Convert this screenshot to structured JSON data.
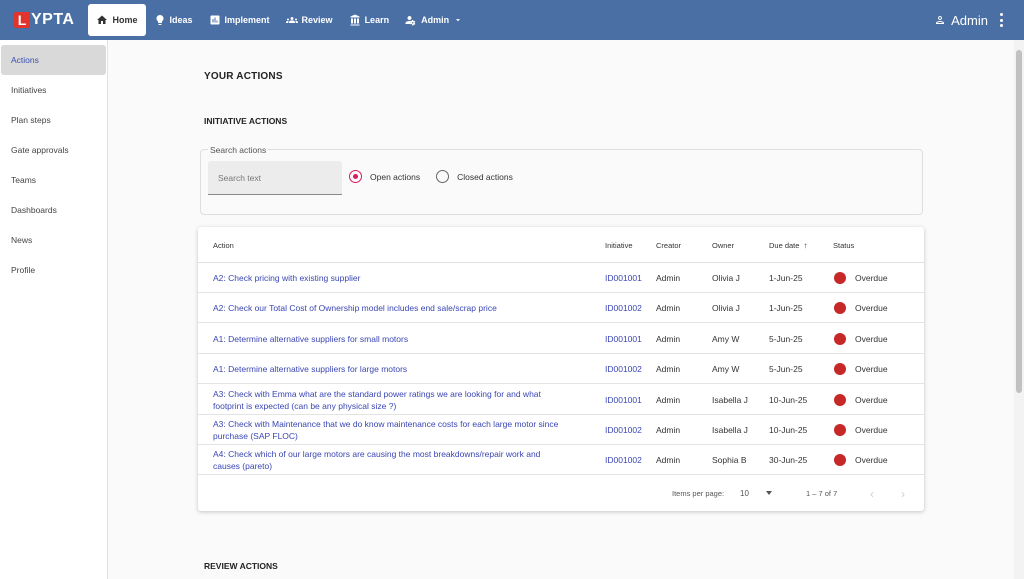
{
  "brand": {
    "logo_letter": "L",
    "logo_rest": "YPTA",
    "logo_color": "#e0342c",
    "topbar_color": "#4a6fa5"
  },
  "nav": {
    "items": [
      {
        "label": "Home",
        "icon": "home-icon",
        "active": true
      },
      {
        "label": "Ideas",
        "icon": "lightbulb-icon"
      },
      {
        "label": "Implement",
        "icon": "chart-icon"
      },
      {
        "label": "Review",
        "icon": "group-icon"
      },
      {
        "label": "Learn",
        "icon": "learn-icon"
      },
      {
        "label": "Admin",
        "icon": "admin-gear-icon"
      }
    ]
  },
  "user": {
    "name": "Admin"
  },
  "sidebar": {
    "items": [
      {
        "label": "Actions",
        "active": true
      },
      {
        "label": "Initiatives"
      },
      {
        "label": "Plan steps"
      },
      {
        "label": "Gate approvals"
      },
      {
        "label": "Teams"
      },
      {
        "label": "Dashboards"
      },
      {
        "label": "News"
      },
      {
        "label": "Profile"
      }
    ]
  },
  "page": {
    "title": "YOUR ACTIONS",
    "initiative_section": "INITIATIVE ACTIONS",
    "review_section": "REVIEW ACTIONS"
  },
  "search": {
    "legend": "Search actions",
    "placeholder": "Search text",
    "value": "",
    "open_label": "Open actions",
    "closed_label": "Closed actions",
    "selected": "open"
  },
  "table": {
    "headers": {
      "action": "Action",
      "initiative": "Initiative",
      "creator": "Creator",
      "owner": "Owner",
      "due": "Due date",
      "status": "Status"
    },
    "rows": [
      {
        "action": "A2: Check pricing with existing supplier",
        "initiative": "ID001001",
        "creator": "Admin",
        "owner": "Olivia J",
        "due": "1-Jun-25",
        "status": "Overdue"
      },
      {
        "action": "A2: Check our Total Cost of Ownership model includes end sale/scrap price",
        "initiative": "ID001002",
        "creator": "Admin",
        "owner": "Olivia J",
        "due": "1-Jun-25",
        "status": "Overdue"
      },
      {
        "action": "A1: Determine alternative suppliers for small motors",
        "initiative": "ID001001",
        "creator": "Admin",
        "owner": "Amy W",
        "due": "5-Jun-25",
        "status": "Overdue"
      },
      {
        "action": "A1: Determine alternative suppliers for large motors",
        "initiative": "ID001002",
        "creator": "Admin",
        "owner": "Amy W",
        "due": "5-Jun-25",
        "status": "Overdue"
      },
      {
        "action": "A3: Check with Emma what are the standard power ratings we are looking for and what footprint is expected (can be any physical size ?)",
        "initiative": "ID001001",
        "creator": "Admin",
        "owner": "Isabella J",
        "due": "10-Jun-25",
        "status": "Overdue"
      },
      {
        "action": "A3: Check with Maintenance that we do know maintenance costs for each large motor since purchase (SAP FLOC)",
        "initiative": "ID001002",
        "creator": "Admin",
        "owner": "Isabella J",
        "due": "10-Jun-25",
        "status": "Overdue"
      },
      {
        "action": "A4: Check which of our large motors are causing the most breakdowns/repair work and causes (pareto)",
        "initiative": "ID001002",
        "creator": "Admin",
        "owner": "Sophia B",
        "due": "30-Jun-25",
        "status": "Overdue"
      }
    ],
    "status_color": "#c62828"
  },
  "paginator": {
    "items_label": "Items per page:",
    "page_size": "10",
    "range": "1 – 7 of 7"
  }
}
